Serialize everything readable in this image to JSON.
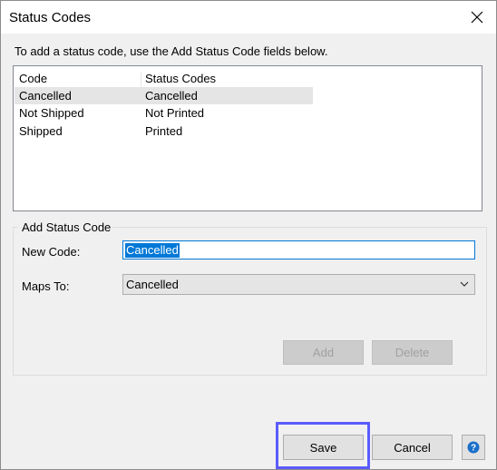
{
  "window": {
    "title": "Status Codes",
    "instruction": "To add a status code, use the Add Status Code fields below."
  },
  "list": {
    "columns": [
      "Code",
      "Status Codes"
    ],
    "rows": [
      {
        "code": "Cancelled",
        "status": "Cancelled",
        "selected": true
      },
      {
        "code": "Not Shipped",
        "status": "Not Printed",
        "selected": false
      },
      {
        "code": "Shipped",
        "status": "Printed",
        "selected": false
      }
    ]
  },
  "add_group": {
    "title": "Add Status Code",
    "new_code_label": "New Code:",
    "new_code_value": "Cancelled",
    "maps_to_label": "Maps To:",
    "maps_to_value": "Cancelled",
    "add_label": "Add",
    "delete_label": "Delete"
  },
  "footer": {
    "save_label": "Save",
    "cancel_label": "Cancel"
  },
  "icons": {
    "close": "close-icon",
    "dropdown": "chevron-down-icon",
    "help": "help-icon"
  },
  "colors": {
    "selection": "#0078d7",
    "highlight": "#5b5bff"
  }
}
